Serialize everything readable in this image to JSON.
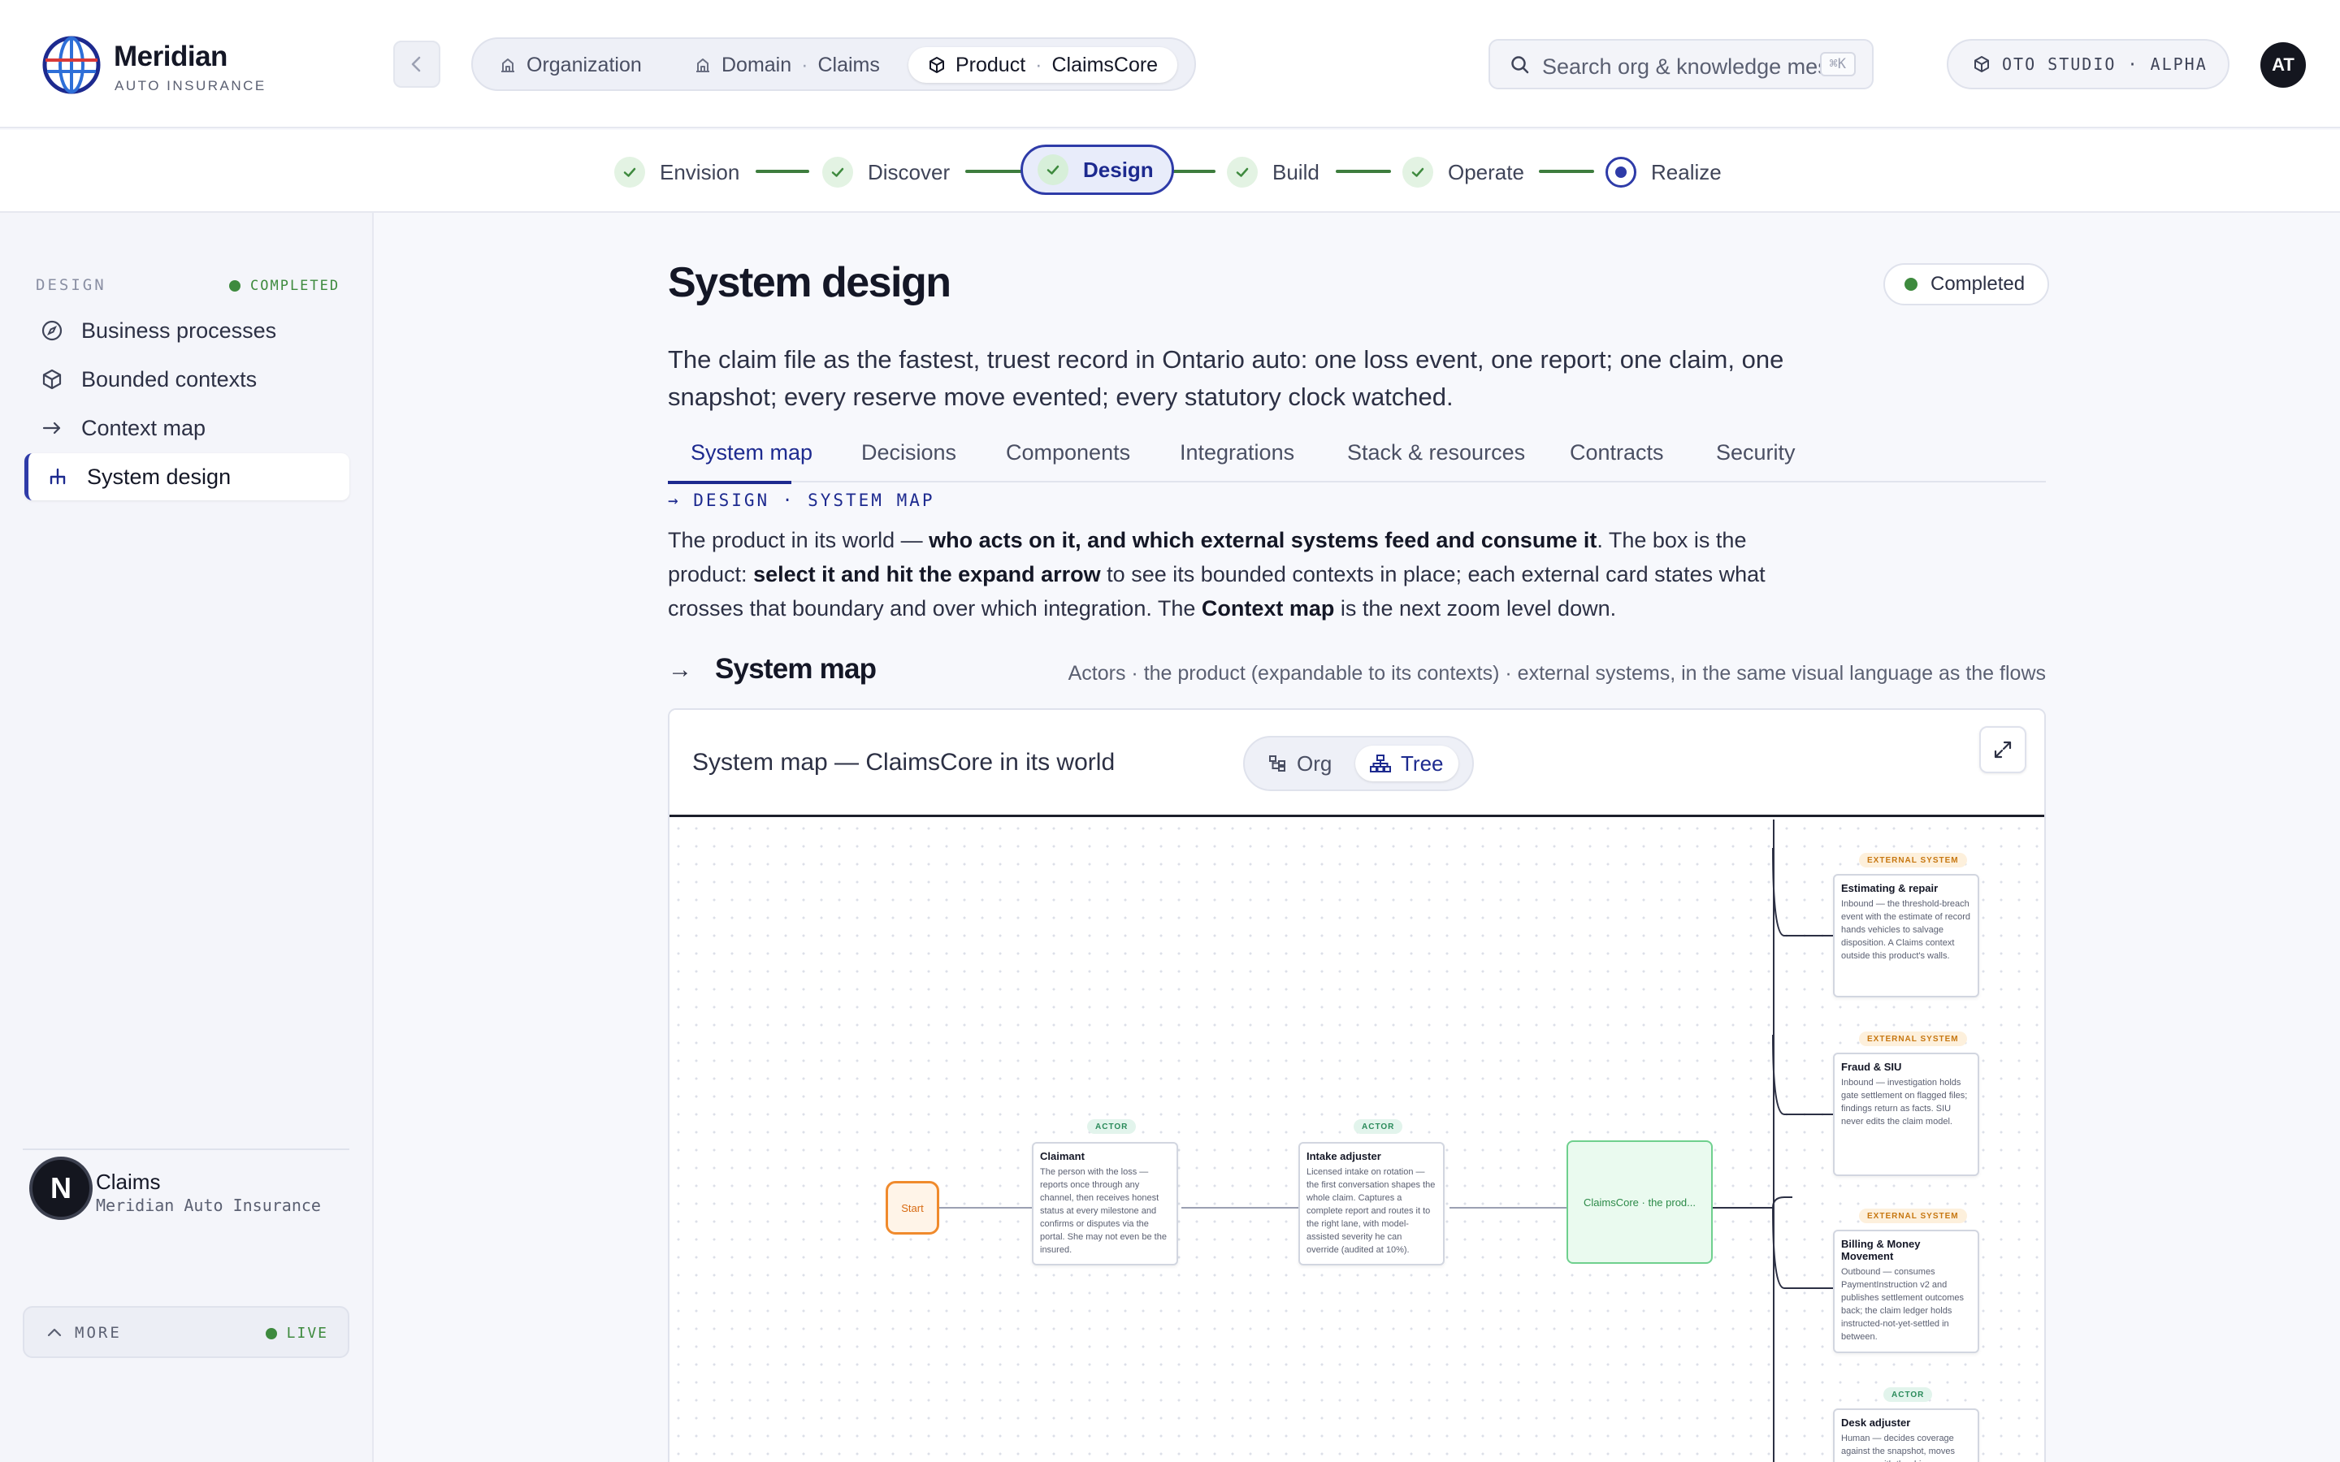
{
  "brand": {
    "name": "Meridian",
    "sub": "AUTO INSURANCE"
  },
  "breadcrumb": {
    "org": "Organization",
    "domain_label": "Domain",
    "domain_value": "Claims",
    "product_label": "Product",
    "product_value": "ClaimsCore",
    "separator": "·"
  },
  "search": {
    "placeholder": "Search org & knowledge mesh",
    "shortcut": "⌘K"
  },
  "studio": {
    "label": "OTO STUDIO · ALPHA"
  },
  "user_initials": "AT",
  "stepper": [
    "Envision",
    "Discover",
    "Design",
    "Build",
    "Operate",
    "Realize"
  ],
  "sidebar": {
    "section": "DESIGN",
    "status": "COMPLETED",
    "items": [
      "Business processes",
      "Bounded contexts",
      "Context map",
      "System design"
    ],
    "more": "MORE",
    "live": "LIVE",
    "user": {
      "initial": "N",
      "name": "Claims",
      "org": "Meridian Auto Insurance"
    }
  },
  "page": {
    "title": "System design",
    "status": "Completed",
    "lead": "The claim file as the fastest, truest record in Ontario auto: one loss event, one report; one claim, one snapshot; every reserve move evented; every statutory clock watched.",
    "tabs": [
      "System map",
      "Decisions",
      "Components",
      "Integrations",
      "Stack & resources",
      "Contracts",
      "Security"
    ],
    "eyebrow": "→ DESIGN · SYSTEM MAP",
    "intro": {
      "p1": "The product in its world — ",
      "b1": "who acts on it, and which external systems feed and consume it",
      "p2": ". The box is the product: ",
      "b2": "select it and hit the expand arrow",
      "p3": " to see its bounded contexts in place; each external card states what crosses that boundary and over which integration. The ",
      "b3": "Context map",
      "p4": " is the next zoom level down."
    },
    "section_arrow": "→",
    "section_title": "System map",
    "section_desc": "Actors · the product (expandable to its contexts) · external systems, in the same visual language as the flows"
  },
  "map": {
    "title": "System map — ClaimsCore in its world",
    "toggle": [
      "Org",
      "Tree"
    ],
    "start": "Start",
    "actor_tag": "ACTOR",
    "ext_tag": "EXTERNAL SYSTEM",
    "claimant": {
      "title": "Claimant",
      "body": "The person with the loss — reports once through any channel, then receives honest status at every milestone and confirms or disputes via the portal. She may not even be the insured."
    },
    "intake": {
      "title": "Intake adjuster",
      "body": "Licensed intake on rotation — the first conversation shapes the whole claim. Captures a complete report and routes it to the right lane, with model-assisted severity he can override (audited at 10%)."
    },
    "product": "ClaimsCore · the prod...",
    "estimating": {
      "title": "Estimating & repair",
      "body": "Inbound — the threshold-breach event with the estimate of record hands vehicles to salvage disposition. A Claims context outside this product's walls."
    },
    "fraud": {
      "title": "Fraud & SIU",
      "body": "Inbound — investigation holds gate settlement on flagged files; findings return as facts. SIU never edits the claim model."
    },
    "billing": {
      "title": "Billing & Money Movement",
      "body": "Outbound — consumes PaymentInstruction v2 and publishes settlement outcomes back; the claim ledger holds instructed-not-yet-settled in between."
    },
    "desk": {
      "title": "Desk adjuster",
      "body": "Human — decides coverage against the snapshot, moves reserves with the driver..."
    }
  },
  "colors": {
    "accent": "#1d2a8f",
    "success": "#3e8a3e",
    "start": "#f08a2c",
    "product": "#6fd08e"
  }
}
